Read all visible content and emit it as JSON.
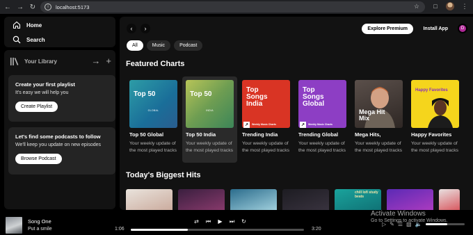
{
  "browser": {
    "url": "localhost:5173",
    "icons": [
      "back-icon",
      "forward-icon",
      "reload-icon",
      "site-info-icon",
      "star-icon",
      "extensions-icon",
      "profile-avatar",
      "menu-icon"
    ]
  },
  "sidebar": {
    "home_label": "Home",
    "search_label": "Search",
    "library_label": "Your Library",
    "playlist_card": {
      "title": "Create your first playlist",
      "text": "It's easy we will help you",
      "button": "Create Playlist"
    },
    "podcast_card": {
      "title": "Let's find some podcasts to follow",
      "text": "We'll keep you update on new episodes",
      "button": "Browse Podcast"
    }
  },
  "header": {
    "explore_label": "Explore Premium",
    "install_label": "Install App",
    "avatar_initial": "D"
  },
  "chips": [
    {
      "label": "All",
      "active": true
    },
    {
      "label": "Music",
      "active": false
    },
    {
      "label": "Podcast",
      "active": false
    }
  ],
  "featured": {
    "title": "Featured Charts",
    "cards": [
      {
        "cover_title": "Top 50",
        "cover_sub": "GLOBAL",
        "name": "Top 50 Global",
        "desc": "Your weekly update of the most played tracks",
        "bg": "linear-gradient(135deg,#2d9ca6,#1a6e99 60%,#2a5d8f)",
        "highlight": false
      },
      {
        "cover_title": "Top 50",
        "cover_sub": "INDIA",
        "name": "Top 50 India",
        "desc": "Your weekly update of the most played tracks",
        "bg": "linear-gradient(135deg,#b7c458,#6e9d52 50%,#3c8658)",
        "highlight": true
      },
      {
        "cover_title": "Top Songs India",
        "cover_sub": "Weekly Music Charts",
        "name": "Trending India",
        "desc": "Your weekly update of the most played tracks",
        "bg": "#d93424",
        "highlight": false
      },
      {
        "cover_title": "Top Songs Global",
        "cover_sub": "Weekly Music Charts",
        "name": "Trending Global",
        "desc": "Your weekly update of the most played tracks",
        "bg": "#8d3ec4",
        "highlight": false
      },
      {
        "cover_title": "Mega Hit Mix",
        "cover_sub": "",
        "name": "Mega Hits,",
        "desc": "Your weekly update of the most played tracks",
        "bg": "linear-gradient(160deg,#5a4f4a,#2e2724)",
        "highlight": false
      },
      {
        "cover_title": "Happy Favorites",
        "cover_sub": "",
        "name": "Happy Favorites",
        "desc": "Your weekly update of the most played tracks",
        "bg": "#f5d51c",
        "highlight": false
      }
    ]
  },
  "hits": {
    "title": "Today's Biggest Hits",
    "tiles": [
      {
        "bg": "linear-gradient(160deg,#e9e3dc,#c9a89a)"
      },
      {
        "bg": "linear-gradient(160deg,#3a1f3f,#8c3b6e)"
      },
      {
        "bg": "linear-gradient(160deg,#2b6c8c,#a8d6e2)"
      },
      {
        "bg": "linear-gradient(160deg,#1d1c22,#3a3440)"
      },
      {
        "bg": "linear-gradient(160deg,#1aa39c,#0f6f73)",
        "text": "chill lofi study beats"
      },
      {
        "bg": "linear-gradient(160deg,#5b2ab5,#b03cc0)"
      },
      {
        "bg": "linear-gradient(160deg,#e8e0e0,#d74d55)"
      }
    ]
  },
  "player": {
    "song": "Song One",
    "artist": "Put a smile",
    "current_time": "1:06",
    "total_time": "3:20",
    "progress": 0.33,
    "volume": 0.55
  },
  "watermark": {
    "line1": "Activate Windows",
    "line2": "Go to Settings to activate Windows."
  }
}
